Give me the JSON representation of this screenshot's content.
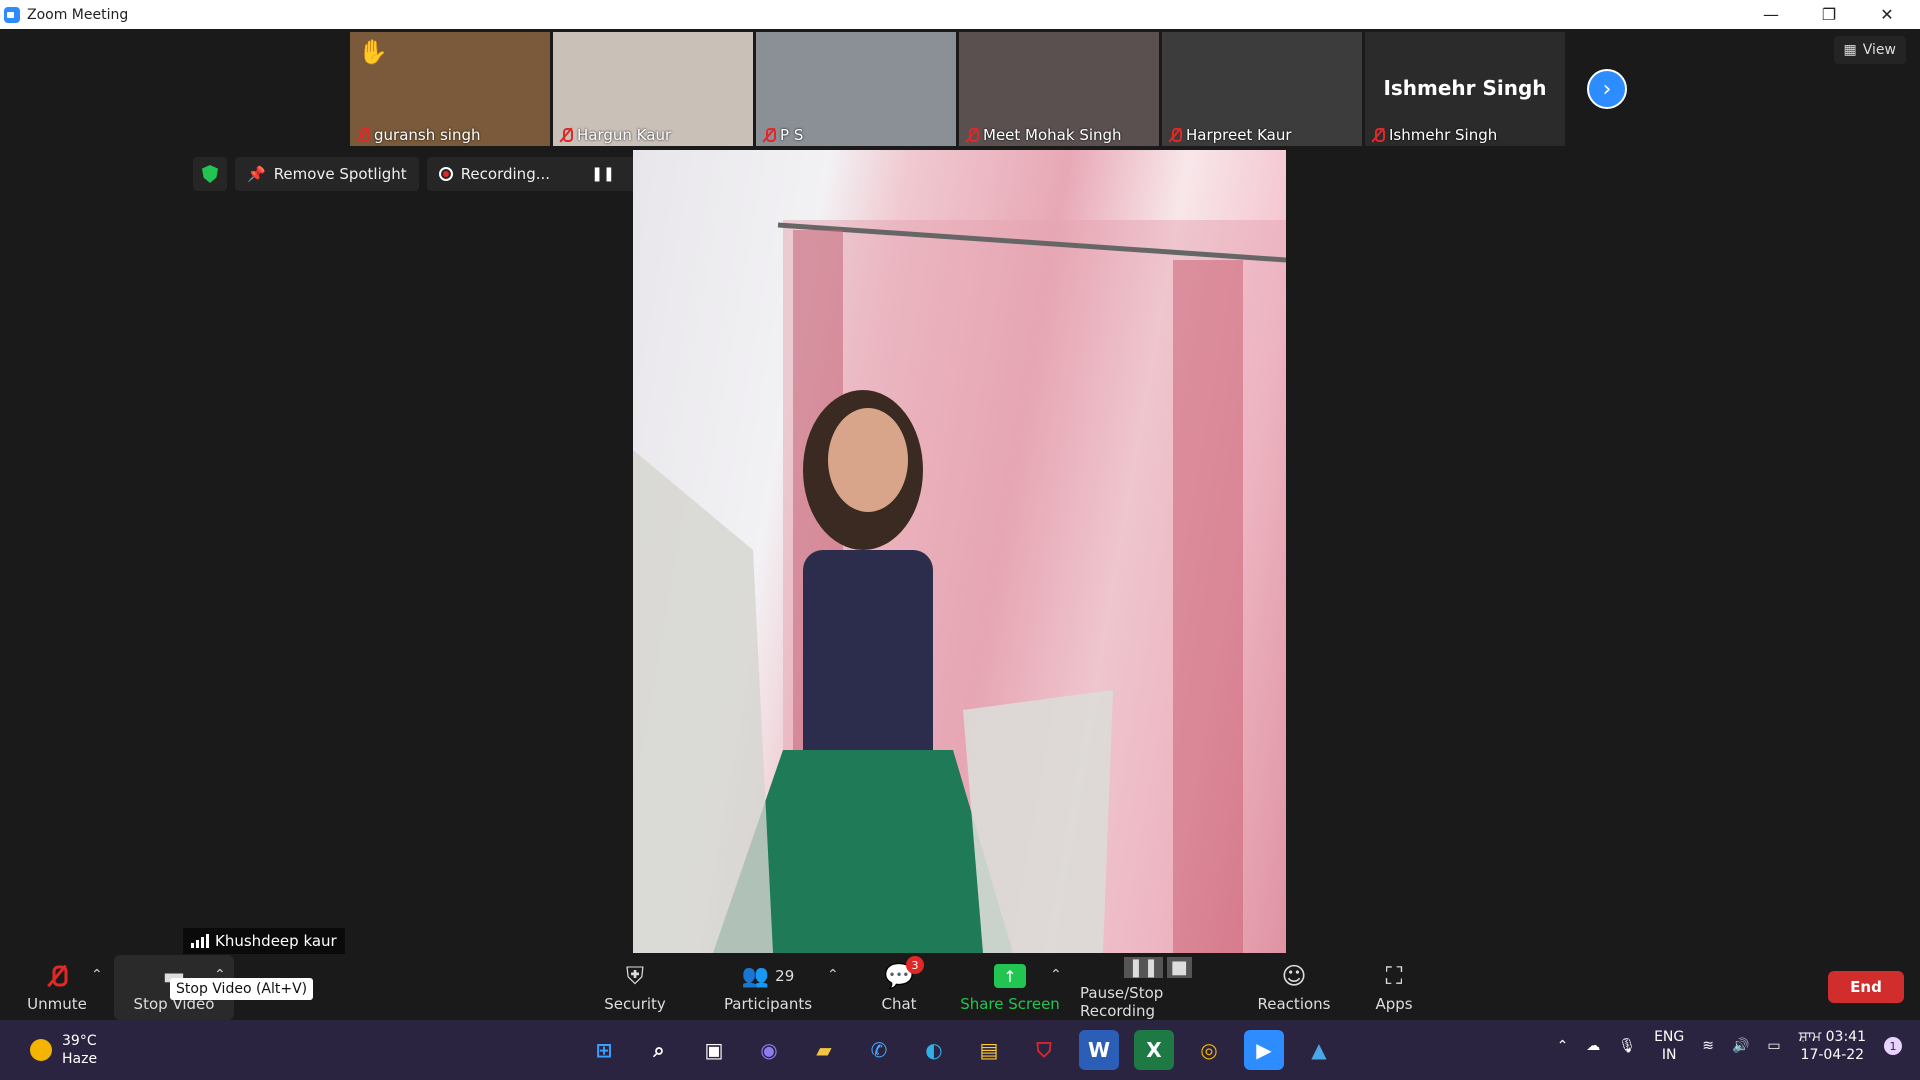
{
  "window": {
    "title": "Zoom Meeting",
    "controls": {
      "minimize": "—",
      "restore": "❐",
      "close": "✕"
    }
  },
  "gallery": {
    "tiles": [
      {
        "name": "guransh singh",
        "bg": "#7a5a3a",
        "hand_raised": true
      },
      {
        "name": "Hargun Kaur",
        "bg": "#c9c0b8",
        "hand_raised": false
      },
      {
        "name": "P S",
        "bg": "#8b8f96",
        "hand_raised": false
      },
      {
        "name": "Meet Mohak Singh",
        "bg": "#5a5050",
        "hand_raised": false
      },
      {
        "name": "Harpreet Kaur",
        "bg": "#3c3c3c",
        "hand_raised": false
      },
      {
        "name": "Ishmehr Singh",
        "bg": "#2b2b2b",
        "hand_raised": false,
        "avatar_text": "Ishmehr Singh"
      }
    ],
    "next_icon": "chevron-right-icon",
    "view_label": "View"
  },
  "controls": {
    "remove_spotlight": "Remove Spotlight",
    "recording": "Recording..."
  },
  "main_video": {
    "speaker": "Khushdeep kaur"
  },
  "toolbar": {
    "unmute": "Unmute",
    "stop_video": "Stop Video",
    "tooltip": "Stop Video (Alt+V)",
    "security": "Security",
    "participants": "Participants",
    "participants_count": "29",
    "chat": "Chat",
    "chat_badge": "3",
    "share_screen": "Share Screen",
    "pause_stop_recording": "Pause/Stop Recording",
    "reactions": "Reactions",
    "apps": "Apps",
    "end": "End"
  },
  "taskbar": {
    "weather_temp": "39°C",
    "weather_desc": "Haze",
    "lang_top": "ENG",
    "lang_bottom": "IN",
    "time": "ਸ਼ਾਮ 03:41",
    "date": "17-04-22",
    "notification_count": "1"
  },
  "colors": {
    "accent": "#2d8cff",
    "danger": "#d12d2d",
    "green": "#23c552"
  }
}
